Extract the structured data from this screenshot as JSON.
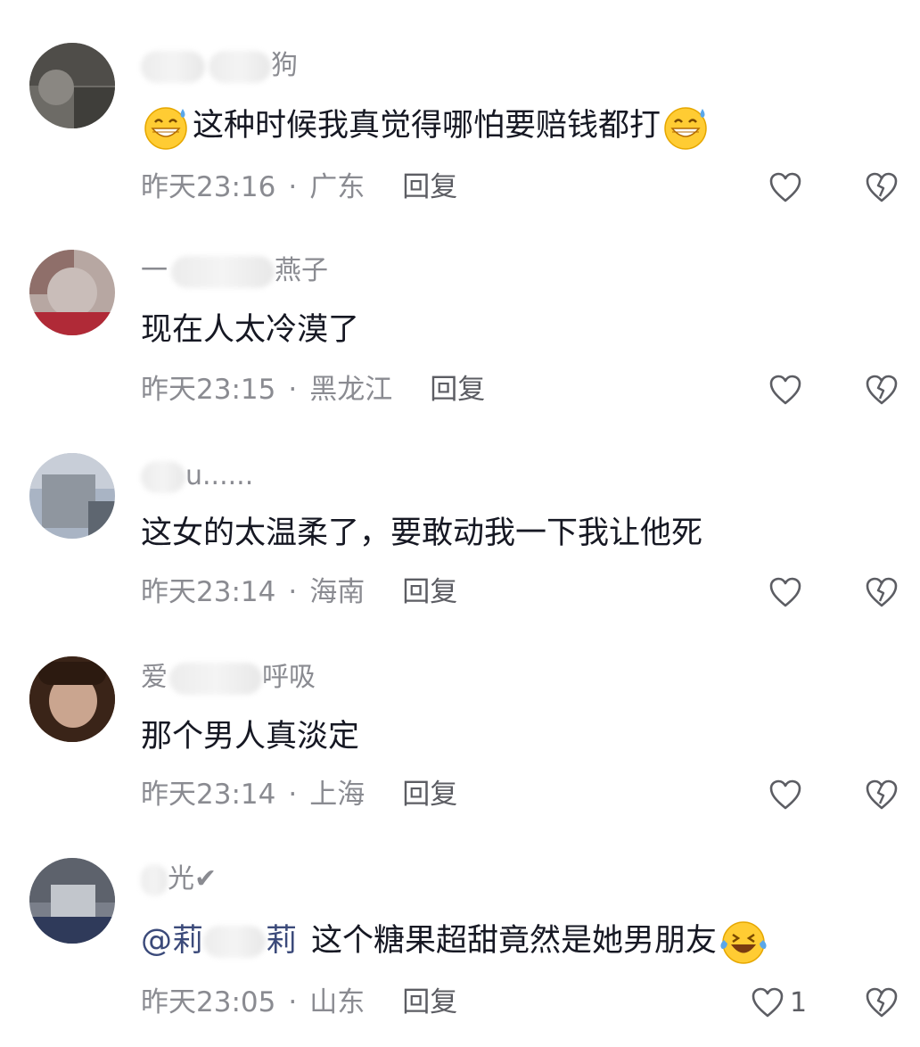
{
  "comments": [
    {
      "name_suffix": "狗",
      "text": "这种时候我真觉得哪怕要赔钱都打",
      "time": "昨天23:16",
      "location": "广东",
      "reply": "回复",
      "likes": ""
    },
    {
      "name_prefix": "一",
      "name_suffix": "燕子",
      "text": "现在人太冷漠了",
      "time": "昨天23:15",
      "location": "黑龙江",
      "reply": "回复",
      "likes": ""
    },
    {
      "name_suffix": "u......",
      "text": "这女的太温柔了，要敢动我一下我让他死",
      "time": "昨天23:14",
      "location": "海南",
      "reply": "回复",
      "likes": ""
    },
    {
      "name_prefix": "爱",
      "name_suffix": "呼吸",
      "text": "那个男人真淡定",
      "time": "昨天23:14",
      "location": "上海",
      "reply": "回复",
      "likes": ""
    },
    {
      "name_suffix": "光✔",
      "mention_prefix": "@莉",
      "mention_suffix": "莉",
      "text": "这个糖果超甜竟然是她男朋友",
      "time": "昨天23:05",
      "location": "山东",
      "reply": "回复",
      "likes": "1"
    }
  ],
  "icons": {
    "like": "heart-outline-icon",
    "dislike": "broken-heart-icon",
    "emoji_sweat": "grinning-sweat-emoji",
    "emoji_tears": "tears-of-joy-emoji"
  },
  "colors": {
    "text": "#161823",
    "meta": "#8a8b91",
    "reply": "#5c5d63",
    "mention": "#3b4a7a"
  }
}
